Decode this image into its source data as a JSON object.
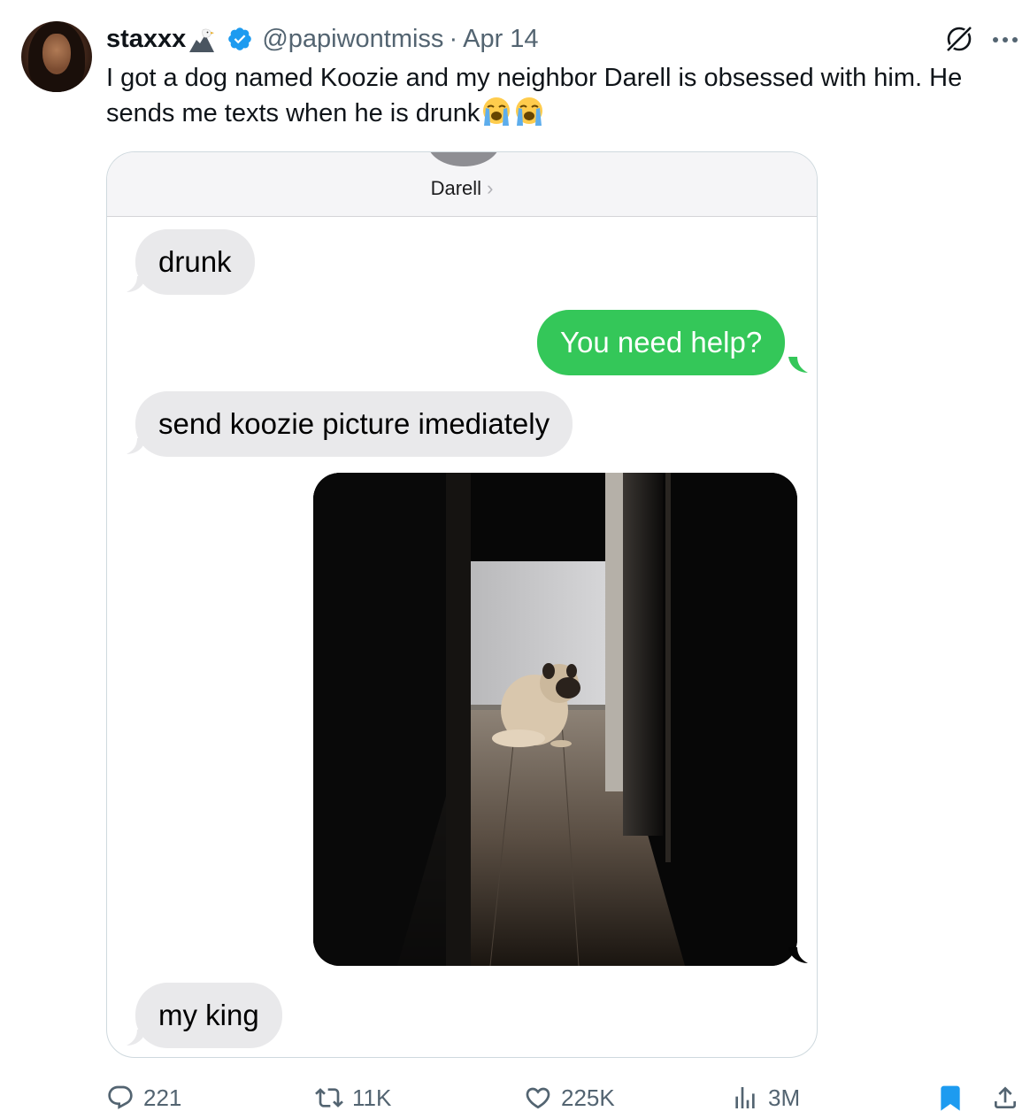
{
  "tweet": {
    "display_name": "staxxx",
    "handle": "@papiwontmiss",
    "separator": "·",
    "date": "Apr 14",
    "text": "I got a dog named Koozie and my neighbor Darell is obsessed with him. He sends me texts when he is drunk",
    "text_emojis": [
      "loudly-crying-face",
      "loudly-crying-face"
    ]
  },
  "conversation": {
    "contact_name": "Darell",
    "contact_chevron": "›",
    "messages": [
      {
        "direction": "received",
        "text": "drunk"
      },
      {
        "direction": "sent",
        "text": "You need help?"
      },
      {
        "direction": "received",
        "text": "send koozie picture imediately"
      },
      {
        "direction": "sent",
        "type": "photo",
        "subject": "pug-in-doorway"
      },
      {
        "direction": "received",
        "text": "my king"
      }
    ]
  },
  "actions": {
    "replies": "221",
    "reposts": "11K",
    "likes": "225K",
    "views": "3M"
  },
  "colors": {
    "verified_blue": "#1d9bf0",
    "imessage_green": "#34c759",
    "received_gray": "#e9e9eb",
    "secondary_text": "#536471",
    "bookmark_active": "#1d9bf0"
  },
  "icons": [
    "eagle-emoji-icon",
    "verified-badge-icon",
    "grok-icon",
    "more-icon",
    "reply-icon",
    "repost-icon",
    "like-icon",
    "views-icon",
    "bookmark-icon",
    "share-icon"
  ]
}
